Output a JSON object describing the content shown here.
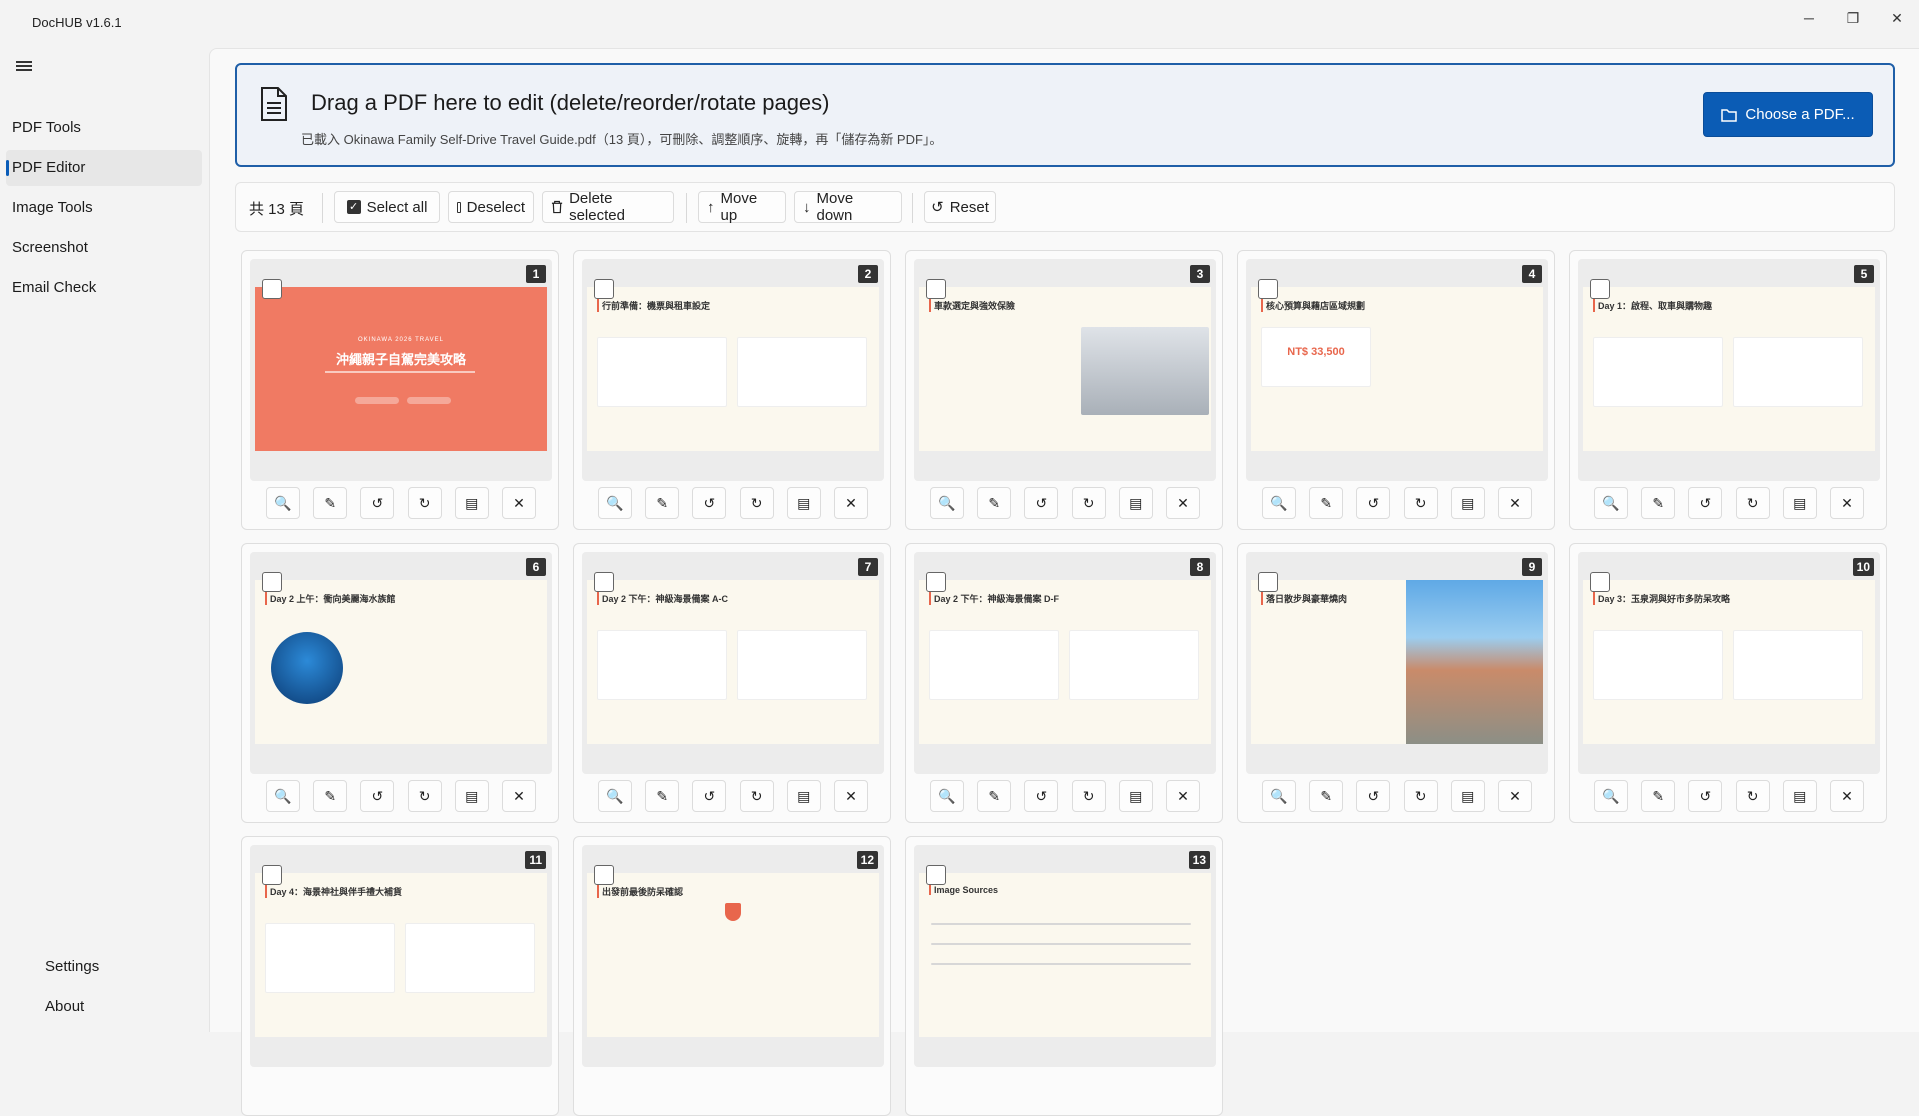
{
  "app": {
    "title": "DocHUB v1.6.1"
  },
  "window": {
    "minimize": "─",
    "maximize": "❐",
    "close": "✕"
  },
  "sidebar": {
    "items": [
      {
        "label": "PDF Tools"
      },
      {
        "label": "PDF Editor",
        "active": true
      },
      {
        "label": "Image Tools"
      },
      {
        "label": "Screenshot"
      },
      {
        "label": "Email Check"
      }
    ],
    "settings": "Settings",
    "about": "About"
  },
  "dropzone": {
    "title": "Drag a PDF here to edit (delete/reorder/rotate pages)",
    "subtitle": "已載入 Okinawa Family Self-Drive Travel Guide.pdf（13 頁），可刪除、調整順序、旋轉，再「儲存為新 PDF」。",
    "choose_label": "Choose a PDF..."
  },
  "toolbar": {
    "count": "共 13 頁",
    "select_all": "Select all",
    "deselect": "Deselect",
    "delete_selected": "Delete selected",
    "move_up": "Move up",
    "move_down": "Move down",
    "reset": "Reset"
  },
  "pages": [
    {
      "num": "1",
      "title": "沖繩親子自駕完美攻略"
    },
    {
      "num": "2",
      "title": "行前準備：機票與租車設定"
    },
    {
      "num": "3",
      "title": "車款選定與強效保險"
    },
    {
      "num": "4",
      "title": "核心預算與藉店區域規劃"
    },
    {
      "num": "5",
      "title": "Day 1：啟程、取車與購物趣"
    },
    {
      "num": "6",
      "title": "Day 2 上午：衝向美麗海水族館"
    },
    {
      "num": "7",
      "title": "Day 2 下午：神級海景備案 A-C"
    },
    {
      "num": "8",
      "title": "Day 2 下午：神級海景備案 D-F"
    },
    {
      "num": "9",
      "title": "落日散步與豪華燒肉"
    },
    {
      "num": "10",
      "title": "Day 3：玉泉洞與好市多防呆攻略"
    },
    {
      "num": "11",
      "title": "Day 4：海景神社與伴手禮大補貨"
    },
    {
      "num": "12",
      "title": "出發前最後防呆確認"
    },
    {
      "num": "13",
      "title": "Image Sources"
    }
  ],
  "page1": {
    "eyebrow": "OKINAWA 2026 TRAVEL",
    "budget": "NT$ 33,500"
  },
  "colors": {
    "accent": "#0b5cb5",
    "cover": "#f07a63"
  }
}
